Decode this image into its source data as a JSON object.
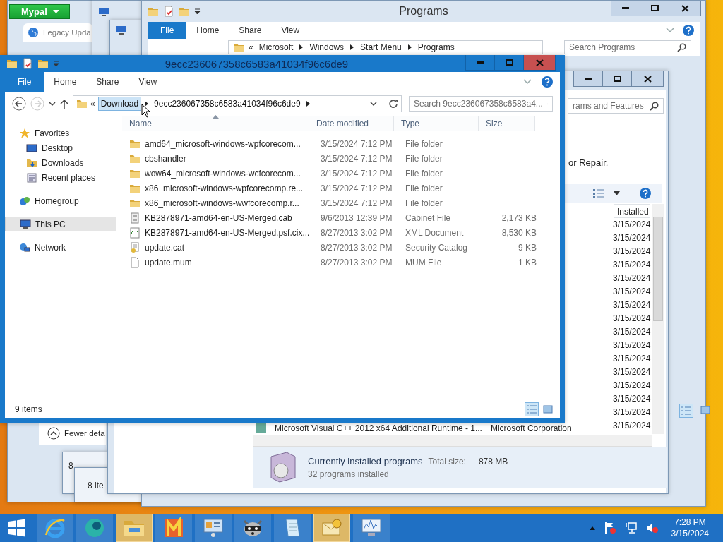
{
  "browser_window": {
    "menu_button": "Mypal",
    "tab": "Legacy Upda",
    "details_toggle": "Fewer deta"
  },
  "stacked_windows": [
    {
      "status": "8"
    },
    {
      "status": "8 ite"
    }
  ],
  "programs_window": {
    "title": "Programs",
    "ribbon_tabs": [
      {
        "label": "File",
        "kind": "menu"
      },
      {
        "label": "Home",
        "kind": "tab"
      },
      {
        "label": "Share",
        "kind": "tab"
      },
      {
        "label": "View",
        "kind": "tab"
      }
    ],
    "breadcrumb": [
      "«",
      "Microsoft",
      "Windows",
      "Start Menu",
      "Programs"
    ],
    "search": {
      "placeholder": "Search Programs"
    }
  },
  "programs_features_window": {
    "search": {
      "placeholder": "rams and Features"
    },
    "instruction": "or Repair.",
    "column": "Installed",
    "dates": [
      "3/15/2024",
      "3/15/2024",
      "3/15/2024",
      "3/15/2024",
      "3/15/2024",
      "3/15/2024",
      "3/15/2024",
      "3/15/2024",
      "3/15/2024",
      "3/15/2024",
      "3/15/2024",
      "3/15/2024",
      "3/15/2024",
      "3/15/2024",
      "3/15/2024",
      "3/15/2024"
    ],
    "program": {
      "name": "Microsoft Visual C++ 2012 x64 Additional Runtime - 1...",
      "publisher": "Microsoft Corporation"
    },
    "details": {
      "title": "Currently installed programs",
      "total_size_label": "Total size:",
      "total_size": "878 MB",
      "count": "32 programs installed"
    }
  },
  "explorer_window": {
    "title": "9ecc236067358c6583a41034f96c6de9",
    "ribbon_tabs": [
      {
        "label": "File",
        "kind": "menu"
      },
      {
        "label": "Home",
        "kind": "tab"
      },
      {
        "label": "Share",
        "kind": "tab"
      },
      {
        "label": "View",
        "kind": "tab"
      }
    ],
    "address": {
      "overflow": "«",
      "crumbs": [
        {
          "label": "Download",
          "highlighted": true
        },
        {
          "label": "9ecc236067358c6583a41034f96c6de9",
          "highlighted": false
        }
      ]
    },
    "search": {
      "placeholder": "Search 9ecc236067358c6583a4..."
    },
    "nav": [
      {
        "label": "Favorites",
        "kind": "favorites",
        "selected": false,
        "children": [
          {
            "label": "Desktop",
            "kind": "desktop",
            "selected": false
          },
          {
            "label": "Downloads",
            "kind": "downloads",
            "selected": false
          },
          {
            "label": "Recent places",
            "kind": "recent",
            "selected": false
          }
        ]
      },
      {
        "label": "Homegroup",
        "kind": "homegroup",
        "selected": false
      },
      {
        "label": "This PC",
        "kind": "pc",
        "selected": true
      },
      {
        "label": "Network",
        "kind": "network",
        "selected": false
      }
    ],
    "columns": [
      {
        "label": "Name",
        "sorted": true
      },
      {
        "label": "Date modified",
        "sorted": false
      },
      {
        "label": "Type",
        "sorted": false
      },
      {
        "label": "Size",
        "sorted": false
      }
    ],
    "files": [
      {
        "name": "amd64_microsoft-windows-wpfcorecom...",
        "date": "3/15/2024 7:12 PM",
        "type": "File folder",
        "kind": "folder"
      },
      {
        "name": "cbshandler",
        "date": "3/15/2024 7:12 PM",
        "type": "File folder",
        "kind": "folder"
      },
      {
        "name": "wow64_microsoft-windows-wcfcorecom...",
        "date": "3/15/2024 7:12 PM",
        "type": "File folder",
        "kind": "folder"
      },
      {
        "name": "x86_microsoft-windows-wpfcorecomp.re...",
        "date": "3/15/2024 7:12 PM",
        "type": "File folder",
        "kind": "folder"
      },
      {
        "name": "x86_microsoft-windows-wwfcorecomp.r...",
        "date": "3/15/2024 7:12 PM",
        "type": "File folder",
        "kind": "folder"
      },
      {
        "name": "KB2878971-amd64-en-US-Merged.cab",
        "date": "9/6/2013 12:39 PM",
        "type": "Cabinet File",
        "size": "2,173 KB",
        "kind": "cabinet"
      },
      {
        "name": "KB2878971-amd64-en-US-Merged.psf.cix...",
        "date": "8/27/2013 3:02 PM",
        "type": "XML Document",
        "size": "8,530 KB",
        "kind": "xml"
      },
      {
        "name": "update.cat",
        "date": "8/27/2013 3:02 PM",
        "type": "Security Catalog",
        "size": "9 KB",
        "kind": "catalog"
      },
      {
        "name": "update.mum",
        "date": "8/27/2013 3:02 PM",
        "type": "MUM File",
        "size": "1 KB",
        "kind": "file"
      }
    ],
    "status": "9 items"
  },
  "taskbar": {
    "items": [
      {
        "kind": "start",
        "active": false
      },
      {
        "kind": "browser",
        "active": false
      },
      {
        "kind": "sphere",
        "active": false
      },
      {
        "kind": "explorer",
        "active": true
      },
      {
        "kind": "paint",
        "active": false
      },
      {
        "kind": "server",
        "active": false
      },
      {
        "kind": "raccoon",
        "active": false
      },
      {
        "kind": "notepad",
        "active": false
      },
      {
        "kind": "mail",
        "active": true
      },
      {
        "kind": "monitor",
        "active": false
      }
    ],
    "clock": {
      "time": "7:28 PM",
      "date": "3/15/2024"
    }
  }
}
